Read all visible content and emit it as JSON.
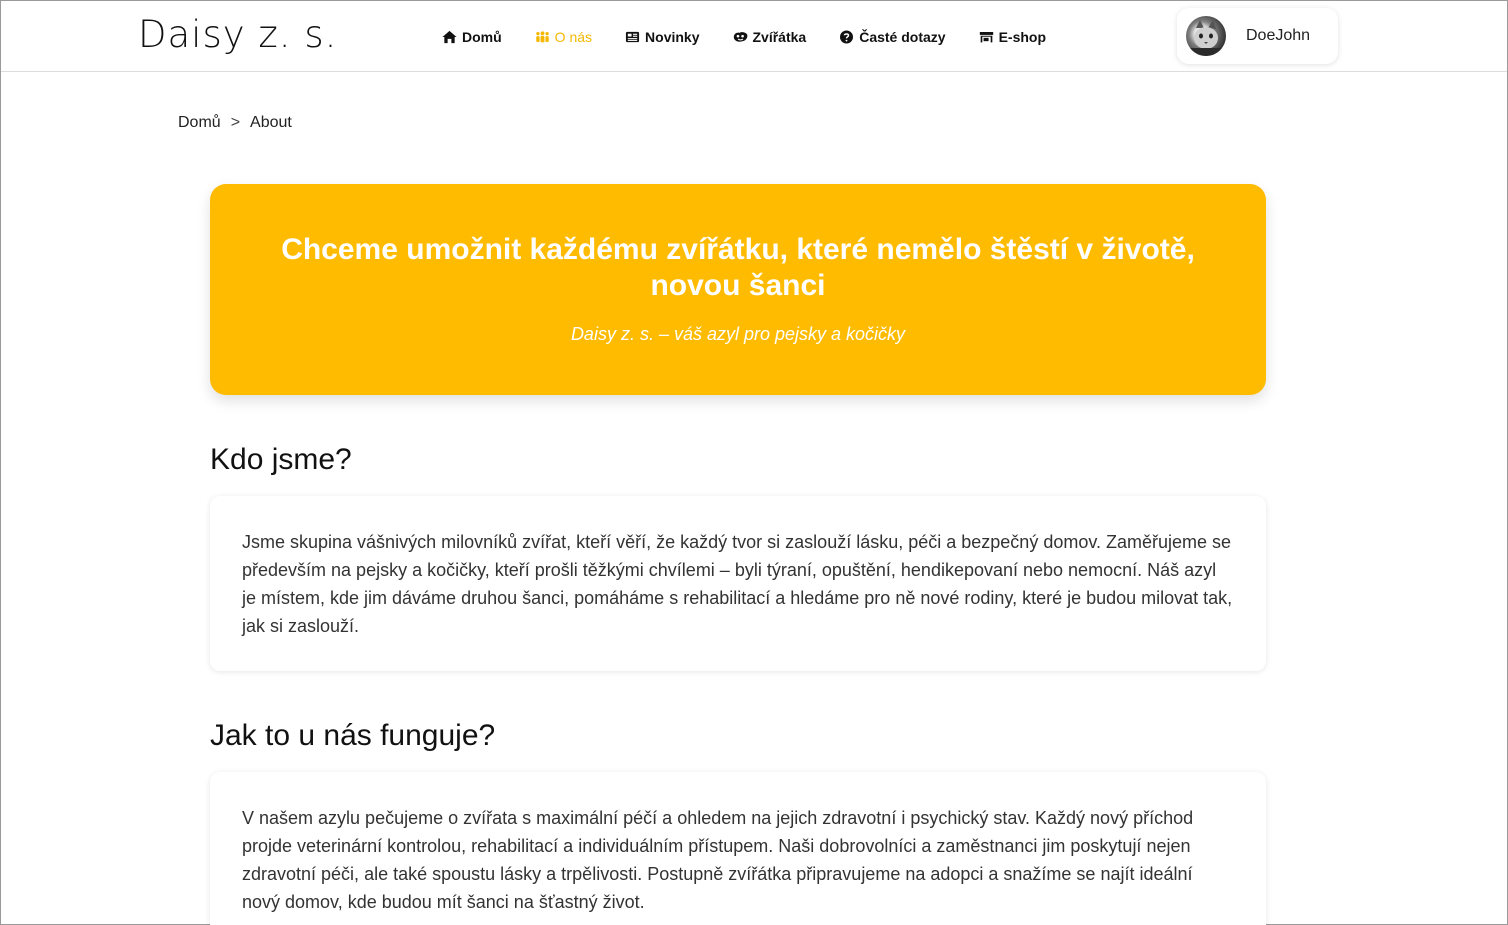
{
  "brand": "Daisy z. s.",
  "nav": {
    "items": [
      {
        "label": "Domů",
        "icon": "home-icon",
        "active": false
      },
      {
        "label": "O nás",
        "icon": "people-icon",
        "active": true
      },
      {
        "label": "Novinky",
        "icon": "newspaper-icon",
        "active": false
      },
      {
        "label": "Zvířátka",
        "icon": "paw-icon",
        "active": false
      },
      {
        "label": "Časté dotazy",
        "icon": "question-icon",
        "active": false
      },
      {
        "label": "E-shop",
        "icon": "store-icon",
        "active": false
      }
    ],
    "active_color": "#f5b800"
  },
  "user": {
    "name": "DoeJohn"
  },
  "breadcrumb": {
    "home": "Domů",
    "separator": ">",
    "current": "About"
  },
  "hero": {
    "title": "Chceme umožnit každému zvířátku, které nemělo štěstí v životě, novou šanci",
    "subtitle": "Daisy z. s. – váš azyl pro pejsky a kočičky",
    "background": "#ffbb00"
  },
  "sections": [
    {
      "title": "Kdo jsme?",
      "text": "Jsme skupina vášnivých milovníků zvířat, kteří věří, že každý tvor si zaslouží lásku, péči a bezpečný domov. Zaměřujeme se především na pejsky a kočičky, kteří prošli těžkými chvílemi – byli týraní, opuštění, hendikepovaní nebo nemocní. Náš azyl je místem, kde jim dáváme druhou šanci, pomáháme s rehabilitací a hledáme pro ně nové rodiny, které je budou milovat tak, jak si zaslouží."
    },
    {
      "title": "Jak to u nás funguje?",
      "text": "V našem azylu pečujeme o zvířata s maximální péčí a ohledem na jejich zdravotní i psychický stav. Každý nový příchod projde veterinární kontrolou, rehabilitací a individuálním přístupem. Naši dobrovolníci a zaměstnanci jim poskytují nejen zdravotní péči, ale také spoustu lásky a trpělivosti. Postupně zvířátka připravujeme na adopci a snažíme se najít ideální nový domov, kde budou mít šanci na šťastný život."
    }
  ]
}
